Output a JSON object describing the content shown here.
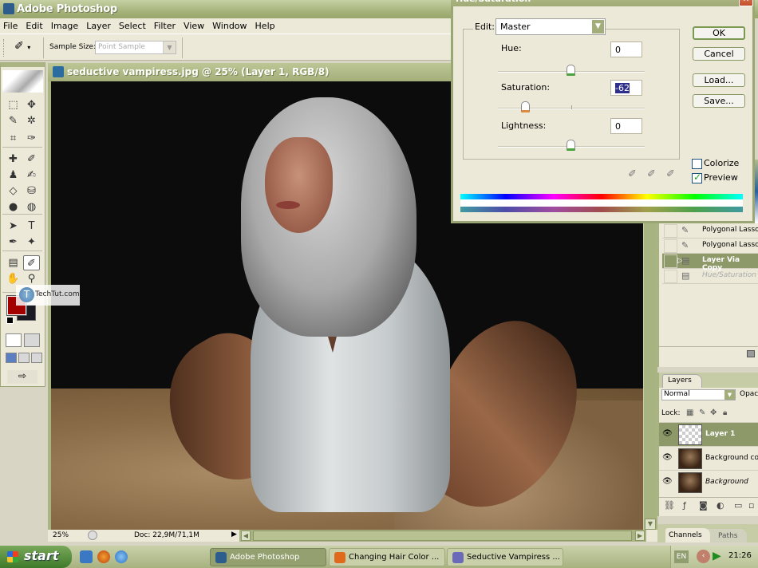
{
  "app": {
    "title": "Adobe Photoshop",
    "menu": [
      "File",
      "Edit",
      "Image",
      "Layer",
      "Select",
      "Filter",
      "View",
      "Window",
      "Help"
    ]
  },
  "options_bar": {
    "tool_icon": "eyedropper-icon",
    "sample_size_label": "Sample Size:",
    "sample_size_value": "Point Sample"
  },
  "toolbox": {
    "tools": [
      {
        "name": "rectangular-marquee",
        "glyph": "⬚"
      },
      {
        "name": "move",
        "glyph": "✥"
      },
      {
        "name": "polygonal-lasso",
        "glyph": "✎"
      },
      {
        "name": "magic-wand",
        "glyph": "✲"
      },
      {
        "name": "crop",
        "glyph": "⌗"
      },
      {
        "name": "slice",
        "glyph": "✑"
      },
      {
        "name": "healing-brush",
        "glyph": "✚"
      },
      {
        "name": "brush",
        "glyph": "✐"
      },
      {
        "name": "clone-stamp",
        "glyph": "♟"
      },
      {
        "name": "history-brush",
        "glyph": "✍"
      },
      {
        "name": "eraser",
        "glyph": "◇"
      },
      {
        "name": "paint-bucket",
        "glyph": "⛁"
      },
      {
        "name": "blur",
        "glyph": "●"
      },
      {
        "name": "dodge",
        "glyph": "◍"
      },
      {
        "name": "path-selection",
        "glyph": "➤"
      },
      {
        "name": "type",
        "glyph": "T"
      },
      {
        "name": "pen",
        "glyph": "✒"
      },
      {
        "name": "custom-shape",
        "glyph": "✦"
      },
      {
        "name": "notes",
        "glyph": "▤"
      },
      {
        "name": "eyedropper",
        "glyph": "✐"
      },
      {
        "name": "hand",
        "glyph": "✋"
      },
      {
        "name": "zoom",
        "glyph": "⚲"
      }
    ],
    "foreground_color": "#a30000",
    "background_color": "#1b1a22",
    "watermark": "TechTut.com"
  },
  "document": {
    "title": "seductive vampiress.jpg @ 25% (Layer 1, RGB/8)",
    "zoom": "25%",
    "doc_size": "Doc: 22,9M/71,1M"
  },
  "dialog": {
    "title": "Hue/Saturation",
    "edit_label": "Edit:",
    "edit_value": "Master",
    "hue_label": "Hue:",
    "hue_value": "0",
    "saturation_label": "Saturation:",
    "saturation_value": "-62",
    "lightness_label": "Lightness:",
    "lightness_value": "0",
    "slider_ranges": {
      "hue": [
        -180,
        180
      ],
      "saturation": [
        -100,
        100
      ],
      "lightness": [
        -100,
        100
      ]
    },
    "buttons": {
      "ok": "OK",
      "cancel": "Cancel",
      "load": "Load...",
      "save": "Save..."
    },
    "colorize_label": "Colorize",
    "colorize_checked": false,
    "preview_label": "Preview",
    "preview_checked": true
  },
  "history": {
    "items": [
      {
        "label": "Polygonal Lasso",
        "icon": "lasso-icon",
        "state": "normal"
      },
      {
        "label": "Polygonal Lasso",
        "icon": "lasso-icon",
        "state": "normal"
      },
      {
        "label": "Layer Via Copy",
        "icon": "layer-icon",
        "state": "active"
      },
      {
        "label": "Hue/Saturation",
        "icon": "layer-icon",
        "state": "disabled"
      }
    ]
  },
  "layers": {
    "tab_label": "Layers",
    "blend_mode": "Normal",
    "opacity_label": "Opac",
    "lock_label": "Lock:",
    "items": [
      {
        "name": "Layer 1",
        "active": true,
        "italic": false,
        "thumb": "transparent"
      },
      {
        "name": "Background cop",
        "active": false,
        "italic": false,
        "thumb": "photo"
      },
      {
        "name": "Background",
        "active": false,
        "italic": true,
        "thumb": "photo"
      }
    ]
  },
  "channels": {
    "tabs": [
      "Channels",
      "Paths"
    ]
  },
  "taskbar": {
    "start_label": "start",
    "tasks": [
      {
        "label": "Adobe Photoshop",
        "active": true,
        "icon_color": "#2c5d8c"
      },
      {
        "label": "Changing Hair Color ...",
        "active": false,
        "icon_color": "#e06a1c"
      },
      {
        "label": "Seductive Vampiress ...",
        "active": false,
        "icon_color": "#6a6ab8"
      }
    ],
    "language": "EN",
    "clock": "21:26"
  }
}
